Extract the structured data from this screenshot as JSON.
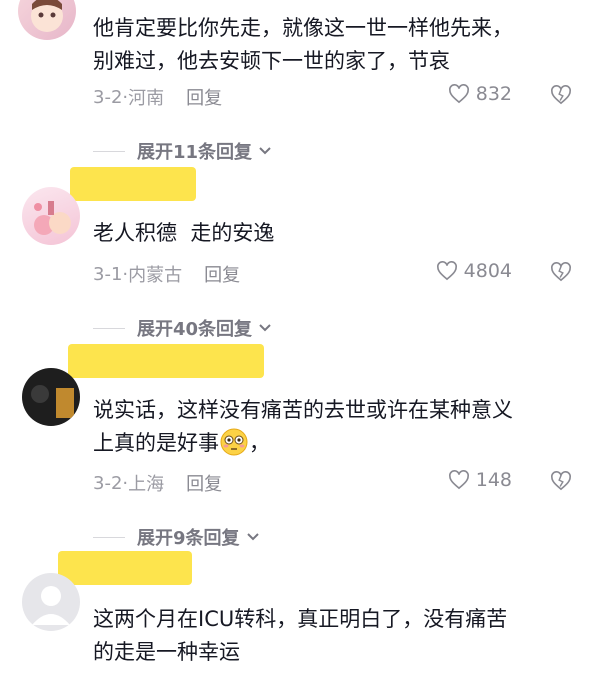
{
  "comments": [
    {
      "username": "",
      "text": "他肯定要比你先走，就像这一世一样他先来，\n别难过，他去安顿下一世的家了，节哀",
      "date": "3-2",
      "location": "河南",
      "reply_label": "回复",
      "likes": "832",
      "expand_label": "展开11条回复"
    },
    {
      "username": "",
      "text": "老人积德  走的安逸",
      "date": "3-1",
      "location": "内蒙古",
      "reply_label": "回复",
      "likes": "4804",
      "expand_label": "展开40条回复"
    },
    {
      "username": "",
      "text": "说实话，这样没有痛苦的去世或许在某种意义\n上真的是好事",
      "text_suffix": "，",
      "date": "3-2",
      "location": "上海",
      "reply_label": "回复",
      "likes": "148",
      "expand_label": "展开9条回复"
    },
    {
      "username": "",
      "text": "这两个月在ICU转科，真正明白了，没有痛苦\n的走是一种幸运"
    }
  ],
  "colors": {
    "highlight": "#fde44d",
    "meta_gray": "#9b9ba3",
    "text": "#161823"
  },
  "icons": [
    "heart-outline-icon",
    "broken-heart-icon",
    "chevron-down-icon",
    "emoji-flushed-icon",
    "default-avatar-icon"
  ]
}
